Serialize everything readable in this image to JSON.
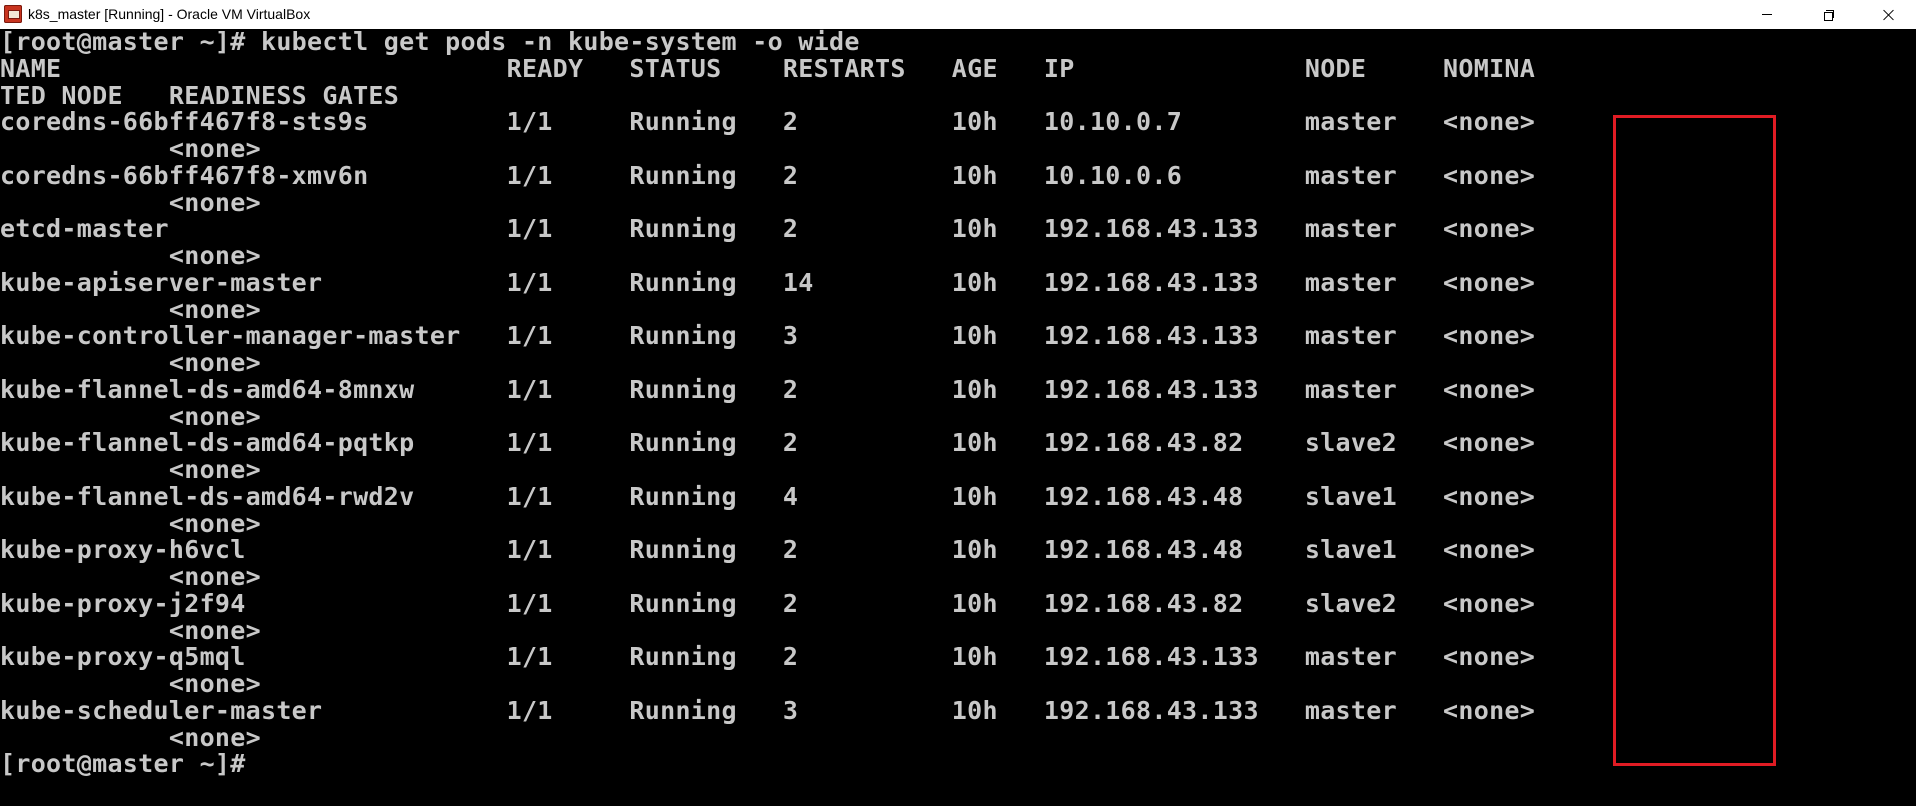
{
  "window": {
    "title": "k8s_master [Running] - Oracle VM VirtualBox",
    "icon": "virtualbox-icon"
  },
  "colors": {
    "terminal_bg": "#000000",
    "terminal_fg": "#c8c8c8",
    "highlight": "#e01c24"
  },
  "terminal": {
    "lines": [
      "[root@master ~]# kubectl get pods -n kube-system -o wide",
      "NAME                             READY   STATUS    RESTARTS   AGE   IP               NODE     NOMINA",
      "TED NODE   READINESS GATES",
      "coredns-66bff467f8-sts9s         1/1     Running   2          10h   10.10.0.7        master   <none>",
      "           <none>",
      "coredns-66bff467f8-xmv6n         1/1     Running   2          10h   10.10.0.6        master   <none>",
      "           <none>",
      "etcd-master                      1/1     Running   2          10h   192.168.43.133   master   <none>",
      "           <none>",
      "kube-apiserver-master            1/1     Running   14         10h   192.168.43.133   master   <none>",
      "           <none>",
      "kube-controller-manager-master   1/1     Running   3          10h   192.168.43.133   master   <none>",
      "           <none>",
      "kube-flannel-ds-amd64-8mnxw      1/1     Running   2          10h   192.168.43.133   master   <none>",
      "           <none>",
      "kube-flannel-ds-amd64-pqtkp      1/1     Running   2          10h   192.168.43.82    slave2   <none>",
      "           <none>",
      "kube-flannel-ds-amd64-rwd2v      1/1     Running   4          10h   192.168.43.48    slave1   <none>",
      "           <none>",
      "kube-proxy-h6vcl                 1/1     Running   2          10h   192.168.43.48    slave1   <none>",
      "           <none>",
      "kube-proxy-j2f94                 1/1     Running   2          10h   192.168.43.82    slave2   <none>",
      "           <none>",
      "kube-proxy-q5mql                 1/1     Running   2          10h   192.168.43.133   master   <none>",
      "           <none>",
      "kube-scheduler-master            1/1     Running   3          10h   192.168.43.133   master   <none>",
      "           <none>",
      "[root@master ~]#"
    ]
  }
}
